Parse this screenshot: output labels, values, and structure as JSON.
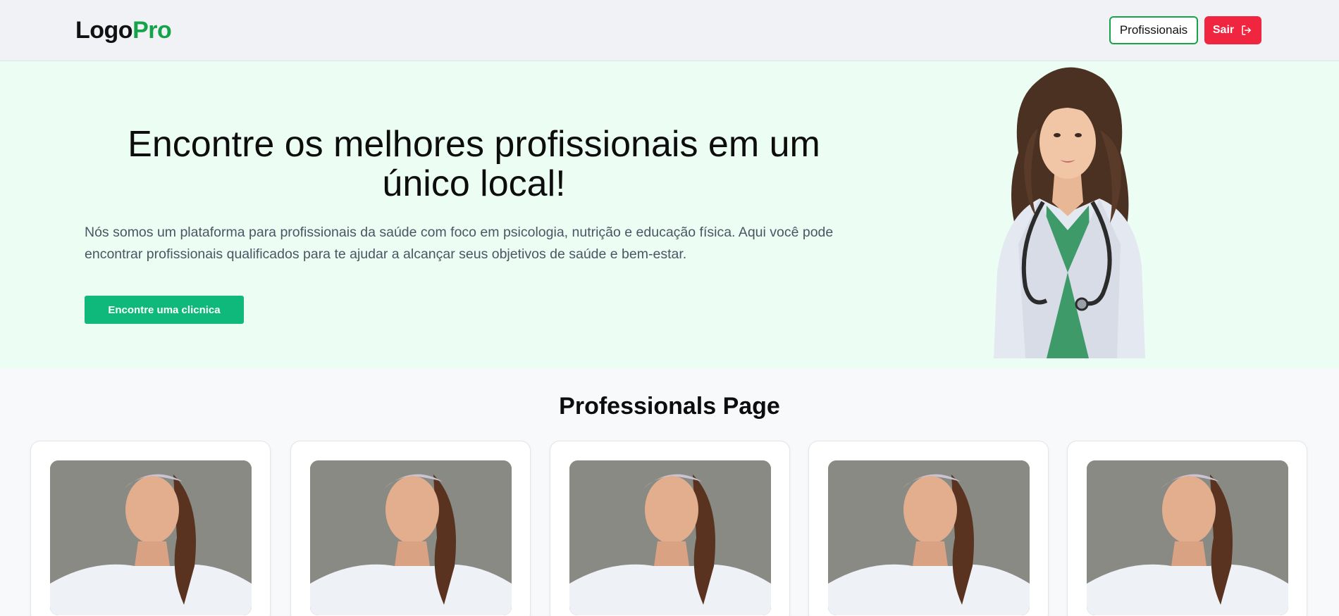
{
  "header": {
    "logo_part1": "Logo",
    "logo_part2": "Pro",
    "professionals_label": "Profissionais",
    "exit_label": "Sair",
    "exit_icon": "logout-icon",
    "colors": {
      "brand_green": "#15a34a",
      "exit_red": "#f0253f"
    }
  },
  "hero": {
    "title": "Encontre os melhores profissionais em um único local!",
    "description": "Nós somos um plataforma para profissionais da saúde com foco em psicologia, nutrição e educação física. Aqui você pode encontrar profissionais qualificados para te ajudar a alcançar seus objetivos de saúde e bem-estar.",
    "cta_label": "Encontre uma clicnica",
    "colors": {
      "background": "#ecfdf3",
      "cta": "#0fb97c"
    }
  },
  "professionals": {
    "title": "Professionals Page",
    "cards": [
      {
        "photo": "professional-photo"
      },
      {
        "photo": "professional-photo"
      },
      {
        "photo": "professional-photo"
      },
      {
        "photo": "professional-photo"
      },
      {
        "photo": "professional-photo"
      }
    ]
  }
}
